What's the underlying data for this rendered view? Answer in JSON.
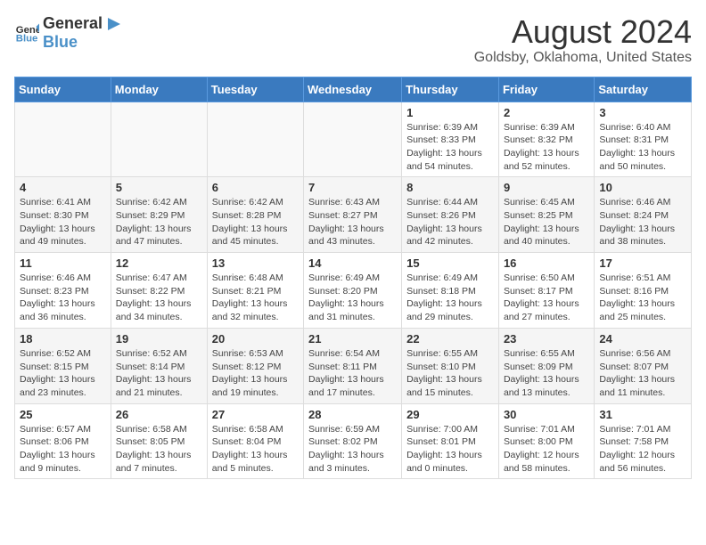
{
  "header": {
    "logo_general": "General",
    "logo_blue": "Blue",
    "title": "August 2024",
    "subtitle": "Goldsby, Oklahoma, United States"
  },
  "weekdays": [
    "Sunday",
    "Monday",
    "Tuesday",
    "Wednesday",
    "Thursday",
    "Friday",
    "Saturday"
  ],
  "weeks": [
    [
      {
        "day": "",
        "info": ""
      },
      {
        "day": "",
        "info": ""
      },
      {
        "day": "",
        "info": ""
      },
      {
        "day": "",
        "info": ""
      },
      {
        "day": "1",
        "info": "Sunrise: 6:39 AM\nSunset: 8:33 PM\nDaylight: 13 hours and 54 minutes."
      },
      {
        "day": "2",
        "info": "Sunrise: 6:39 AM\nSunset: 8:32 PM\nDaylight: 13 hours and 52 minutes."
      },
      {
        "day": "3",
        "info": "Sunrise: 6:40 AM\nSunset: 8:31 PM\nDaylight: 13 hours and 50 minutes."
      }
    ],
    [
      {
        "day": "4",
        "info": "Sunrise: 6:41 AM\nSunset: 8:30 PM\nDaylight: 13 hours and 49 minutes."
      },
      {
        "day": "5",
        "info": "Sunrise: 6:42 AM\nSunset: 8:29 PM\nDaylight: 13 hours and 47 minutes."
      },
      {
        "day": "6",
        "info": "Sunrise: 6:42 AM\nSunset: 8:28 PM\nDaylight: 13 hours and 45 minutes."
      },
      {
        "day": "7",
        "info": "Sunrise: 6:43 AM\nSunset: 8:27 PM\nDaylight: 13 hours and 43 minutes."
      },
      {
        "day": "8",
        "info": "Sunrise: 6:44 AM\nSunset: 8:26 PM\nDaylight: 13 hours and 42 minutes."
      },
      {
        "day": "9",
        "info": "Sunrise: 6:45 AM\nSunset: 8:25 PM\nDaylight: 13 hours and 40 minutes."
      },
      {
        "day": "10",
        "info": "Sunrise: 6:46 AM\nSunset: 8:24 PM\nDaylight: 13 hours and 38 minutes."
      }
    ],
    [
      {
        "day": "11",
        "info": "Sunrise: 6:46 AM\nSunset: 8:23 PM\nDaylight: 13 hours and 36 minutes."
      },
      {
        "day": "12",
        "info": "Sunrise: 6:47 AM\nSunset: 8:22 PM\nDaylight: 13 hours and 34 minutes."
      },
      {
        "day": "13",
        "info": "Sunrise: 6:48 AM\nSunset: 8:21 PM\nDaylight: 13 hours and 32 minutes."
      },
      {
        "day": "14",
        "info": "Sunrise: 6:49 AM\nSunset: 8:20 PM\nDaylight: 13 hours and 31 minutes."
      },
      {
        "day": "15",
        "info": "Sunrise: 6:49 AM\nSunset: 8:18 PM\nDaylight: 13 hours and 29 minutes."
      },
      {
        "day": "16",
        "info": "Sunrise: 6:50 AM\nSunset: 8:17 PM\nDaylight: 13 hours and 27 minutes."
      },
      {
        "day": "17",
        "info": "Sunrise: 6:51 AM\nSunset: 8:16 PM\nDaylight: 13 hours and 25 minutes."
      }
    ],
    [
      {
        "day": "18",
        "info": "Sunrise: 6:52 AM\nSunset: 8:15 PM\nDaylight: 13 hours and 23 minutes."
      },
      {
        "day": "19",
        "info": "Sunrise: 6:52 AM\nSunset: 8:14 PM\nDaylight: 13 hours and 21 minutes."
      },
      {
        "day": "20",
        "info": "Sunrise: 6:53 AM\nSunset: 8:12 PM\nDaylight: 13 hours and 19 minutes."
      },
      {
        "day": "21",
        "info": "Sunrise: 6:54 AM\nSunset: 8:11 PM\nDaylight: 13 hours and 17 minutes."
      },
      {
        "day": "22",
        "info": "Sunrise: 6:55 AM\nSunset: 8:10 PM\nDaylight: 13 hours and 15 minutes."
      },
      {
        "day": "23",
        "info": "Sunrise: 6:55 AM\nSunset: 8:09 PM\nDaylight: 13 hours and 13 minutes."
      },
      {
        "day": "24",
        "info": "Sunrise: 6:56 AM\nSunset: 8:07 PM\nDaylight: 13 hours and 11 minutes."
      }
    ],
    [
      {
        "day": "25",
        "info": "Sunrise: 6:57 AM\nSunset: 8:06 PM\nDaylight: 13 hours and 9 minutes."
      },
      {
        "day": "26",
        "info": "Sunrise: 6:58 AM\nSunset: 8:05 PM\nDaylight: 13 hours and 7 minutes."
      },
      {
        "day": "27",
        "info": "Sunrise: 6:58 AM\nSunset: 8:04 PM\nDaylight: 13 hours and 5 minutes."
      },
      {
        "day": "28",
        "info": "Sunrise: 6:59 AM\nSunset: 8:02 PM\nDaylight: 13 hours and 3 minutes."
      },
      {
        "day": "29",
        "info": "Sunrise: 7:00 AM\nSunset: 8:01 PM\nDaylight: 13 hours and 0 minutes."
      },
      {
        "day": "30",
        "info": "Sunrise: 7:01 AM\nSunset: 8:00 PM\nDaylight: 12 hours and 58 minutes."
      },
      {
        "day": "31",
        "info": "Sunrise: 7:01 AM\nSunset: 7:58 PM\nDaylight: 12 hours and 56 minutes."
      }
    ]
  ]
}
